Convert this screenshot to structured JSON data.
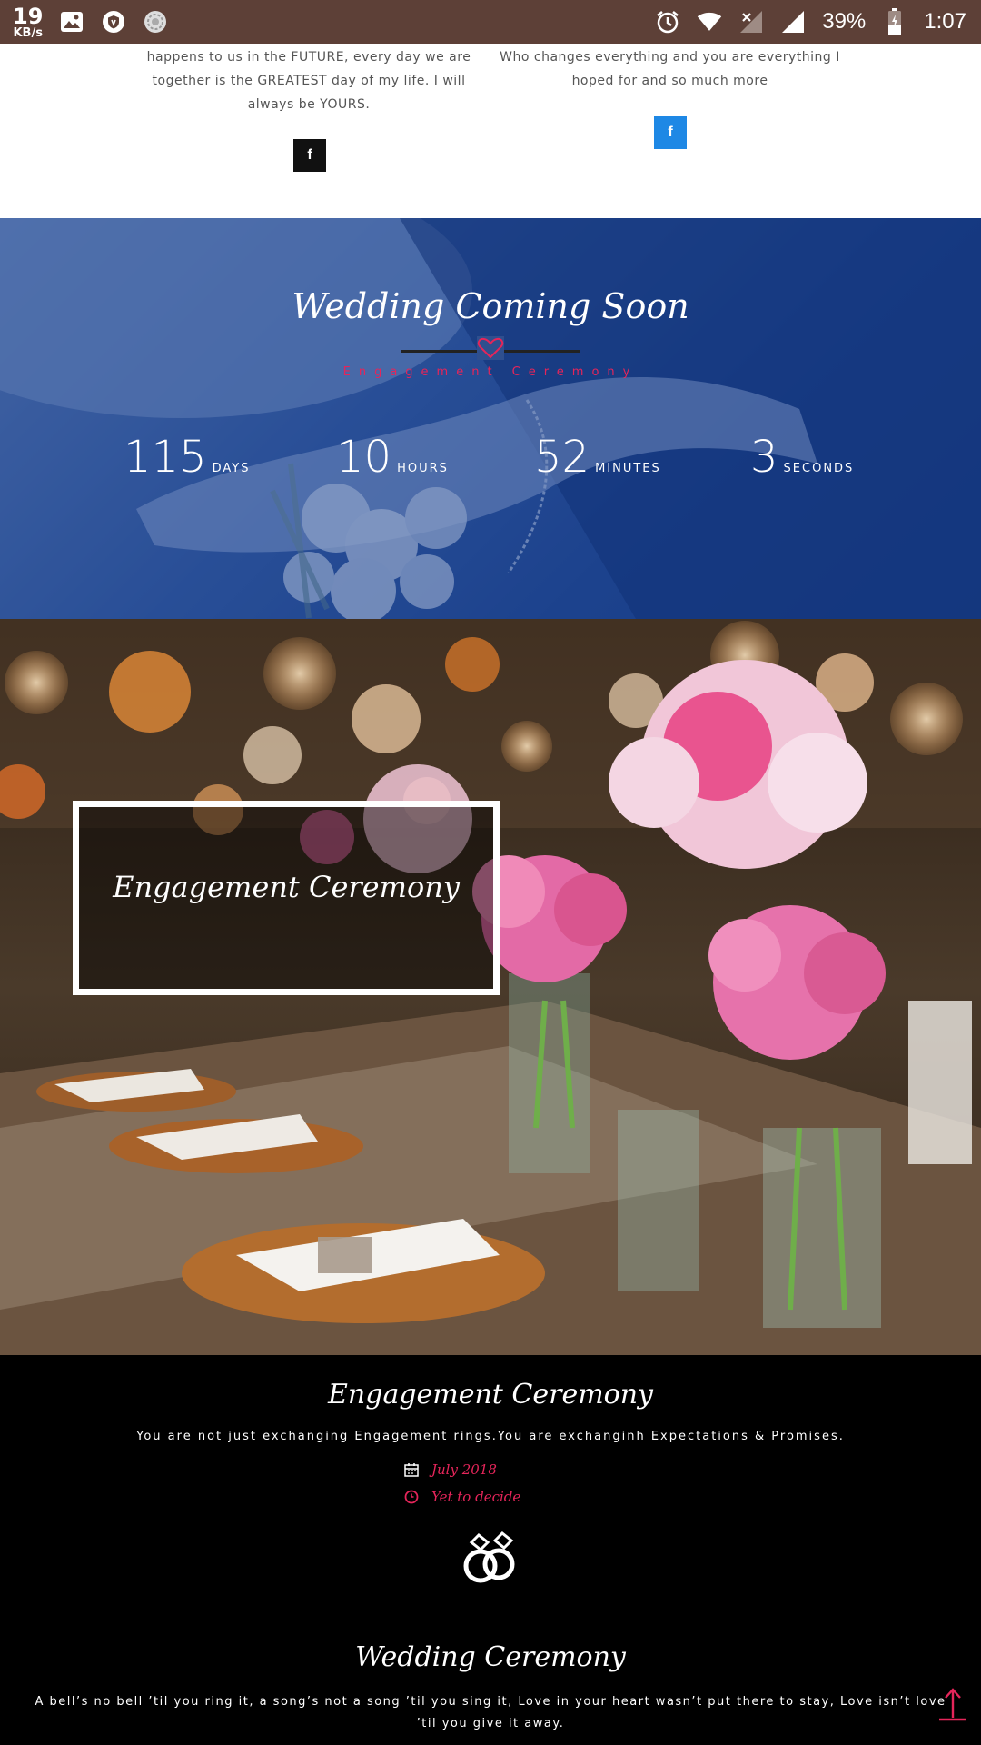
{
  "status_bar": {
    "speed_value": "19",
    "speed_unit": "KB/s",
    "battery": "39%",
    "time": "1:07"
  },
  "top": {
    "quote_left": "happens to us in the FUTURE, every day we are together is the GREATEST day of my life. I will always be YOURS.",
    "quote_right": "Who changes everything and you are everything I hoped for and so much more",
    "fb_label": "f"
  },
  "countdown": {
    "title": "Wedding Coming Soon",
    "subtitle": "Engagement Ceremony",
    "units": [
      {
        "value": "115",
        "label": "DAYS"
      },
      {
        "value": "10",
        "label": "HOURS"
      },
      {
        "value": "52",
        "label": "MINUTES"
      },
      {
        "value": "3",
        "label": "SECONDS"
      }
    ]
  },
  "photo": {
    "frame_title": "Engagement Ceremony"
  },
  "engagement": {
    "title": "Engagement Ceremony",
    "description": "You are not just exchanging Engagement rings.You are exchanginh Expectations & Promises.",
    "date": "July 2018",
    "time": "Yet to decide"
  },
  "wedding": {
    "title": "Wedding Ceremony",
    "quote": "A bell’s no bell ’til you ring it, a song’s not a song ’til you sing it, Love in your heart wasn’t put there to stay, Love isn’t love ’til you give it away."
  },
  "colors": {
    "accent": "#e5255a",
    "status_bar": "#5d4037",
    "facebook": "#1e88e5"
  }
}
